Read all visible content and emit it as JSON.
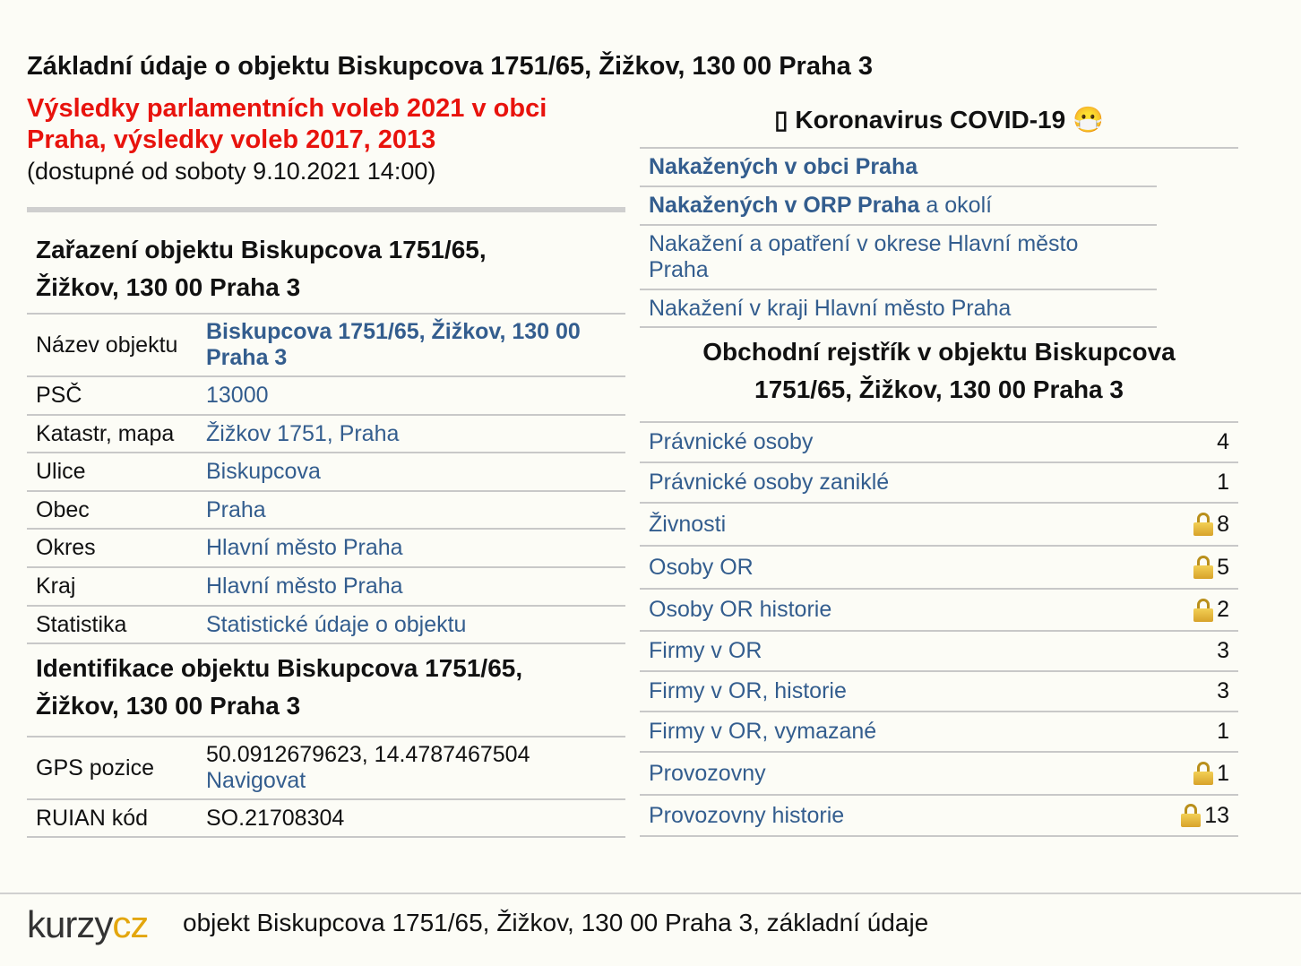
{
  "title": "Základní údaje o objektu Biskupcova 1751/65, Žižkov, 130 00 Praha 3",
  "election": {
    "line1": "Výsledky parlamentních voleb 2021 v obci",
    "line2": "Praha, výsledky voleb 2017, 2013",
    "available": "(dostupné od soboty 9.10.2021 14:00)"
  },
  "zarazeni": {
    "heading_l1": "Zařazení objektu Biskupcova 1751/65,",
    "heading_l2": "Žižkov, 130 00 Praha 3",
    "rows": [
      {
        "key": "Název objektu",
        "value_l1": "Biskupcova 1751/65, Žižkov, 130 00",
        "value_l2": "Praha 3"
      },
      {
        "key": "PSČ",
        "value": "13000"
      },
      {
        "key": "Katastr, mapa",
        "value": "Žižkov 1751, Praha"
      },
      {
        "key": "Ulice",
        "value": "Biskupcova"
      },
      {
        "key": "Obec",
        "value": "Praha"
      },
      {
        "key": "Okres",
        "value": "Hlavní město Praha"
      },
      {
        "key": "Kraj",
        "value": "Hlavní město Praha"
      },
      {
        "key": "Statistika",
        "value": "Statistické údaje o objektu"
      }
    ]
  },
  "identifikace": {
    "heading_l1": "Identifikace objektu Biskupcova 1751/65,",
    "heading_l2": "Žižkov, 130 00 Praha 3",
    "gps_key": "GPS pozice",
    "gps_value": "50.0912679623, 14.4787467504",
    "gps_link": "Navigovat",
    "ruian_key": "RUIAN kód",
    "ruian_value": "SO.21708304"
  },
  "covid": {
    "heading_icon": "▯",
    "heading": "Koronavirus COVID-19",
    "heading_emoji": "😷",
    "items": [
      {
        "link": "Nakažených v obci Praha"
      },
      {
        "link": "Nakažených v ORP Praha",
        "suffix": " a okolí"
      },
      {
        "link_l1": "Nakažení a opatření v okrese Hlavní město",
        "link_l2": "Praha"
      },
      {
        "link": "Nakažení v kraji Hlavní město Praha"
      }
    ]
  },
  "rejstrik": {
    "heading_l1": "Obchodní rejstřík v objektu Biskupcova",
    "heading_l2": "1751/65, Žižkov, 130 00 Praha 3",
    "rows": [
      {
        "label": "Právnické osoby",
        "count": "4",
        "locked": false
      },
      {
        "label": "Právnické osoby zaniklé",
        "count": "1",
        "locked": false
      },
      {
        "label": "Živnosti",
        "count": "8",
        "locked": true
      },
      {
        "label": "Osoby OR",
        "count": "5",
        "locked": true
      },
      {
        "label": "Osoby OR historie",
        "count": "2",
        "locked": true
      },
      {
        "label": "Firmy v OR",
        "count": "3",
        "locked": false
      },
      {
        "label": "Firmy v OR, historie",
        "count": "3",
        "locked": false
      },
      {
        "label": "Firmy v OR, vymazané",
        "count": "1",
        "locked": false
      },
      {
        "label": "Provozovny",
        "count": "1",
        "locked": true
      },
      {
        "label": "Provozovny historie",
        "count": "13",
        "locked": true
      }
    ]
  },
  "footer": {
    "logo_part1": "kurzy",
    "logo_part2": "cz",
    "text": "objekt Biskupcova 1751/65, Žižkov, 130 00 Praha 3, základní údaje"
  },
  "colors": {
    "link": "#335d8e",
    "election": "#e8130d",
    "logo_accent": "#e3a60e",
    "background": "#fcfcf6"
  }
}
